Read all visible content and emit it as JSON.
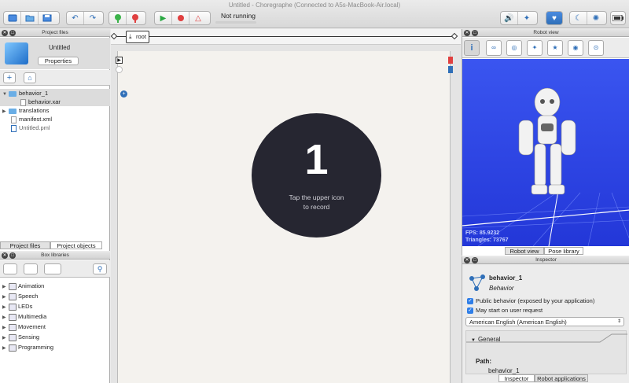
{
  "window": {
    "title": "Untitled - Choregraphe (Connected to A5s-MacBook-Air.local)",
    "status": "Not running"
  },
  "toolbar": {
    "icons_left": [
      "new-project-icon",
      "open-project-icon",
      "save-project-icon"
    ],
    "icons_undo": [
      "undo-icon",
      "redo-icon"
    ],
    "icons_connect": [
      "connect-icon",
      "disconnect-icon"
    ],
    "icons_play": [
      "play-icon",
      "stop-icon",
      "debug-icon"
    ],
    "icons_right": [
      "volume-icon",
      "animation-mode-icon",
      "heart-icon",
      "sleep-icon",
      "settings-icon",
      "battery-icon"
    ]
  },
  "project_files": {
    "header": "Project files",
    "project_name": "Untitled",
    "properties_button": "Properties",
    "tree": [
      {
        "label": "behavior_1",
        "type": "folder",
        "expanded": true,
        "selected": true
      },
      {
        "label": "behavior.xar",
        "type": "file",
        "child": true,
        "selected": true
      },
      {
        "label": "translations",
        "type": "folder",
        "expanded": false
      },
      {
        "label": "manifest.xml",
        "type": "file"
      },
      {
        "label": "Untitled.pml",
        "type": "pml"
      }
    ],
    "tabs": [
      "Project files",
      "Project objects"
    ]
  },
  "box_libraries": {
    "header": "Box libraries",
    "items": [
      "Animation",
      "Speech",
      "LEDs",
      "Multimedia",
      "Movement",
      "Sensing",
      "Programming"
    ]
  },
  "flow": {
    "breadcrumb": "root",
    "record_number": "1",
    "record_line1": "Tap the upper icon",
    "record_line2": "to record"
  },
  "robot_view": {
    "header": "Robot view",
    "fps": "FPS: 85.9232",
    "triangles": "Triangles: 73767",
    "tabs": [
      "Robot view",
      "Pose library"
    ],
    "icons": [
      "info-icon",
      "link-icon",
      "joints-icon",
      "stiffness-icon",
      "animation-icon",
      "speaker-icon",
      "camera-icon"
    ]
  },
  "inspector": {
    "header": "Inspector",
    "name": "behavior_1",
    "type": "Behavior",
    "check1": "Public behavior (exposed by your application)",
    "check2": "May start on user request",
    "language": "American English (American English)",
    "section": "General",
    "path_label": "Path:",
    "path_value": "behavior_1",
    "tabs": [
      "Inspector",
      "Robot applications"
    ]
  }
}
